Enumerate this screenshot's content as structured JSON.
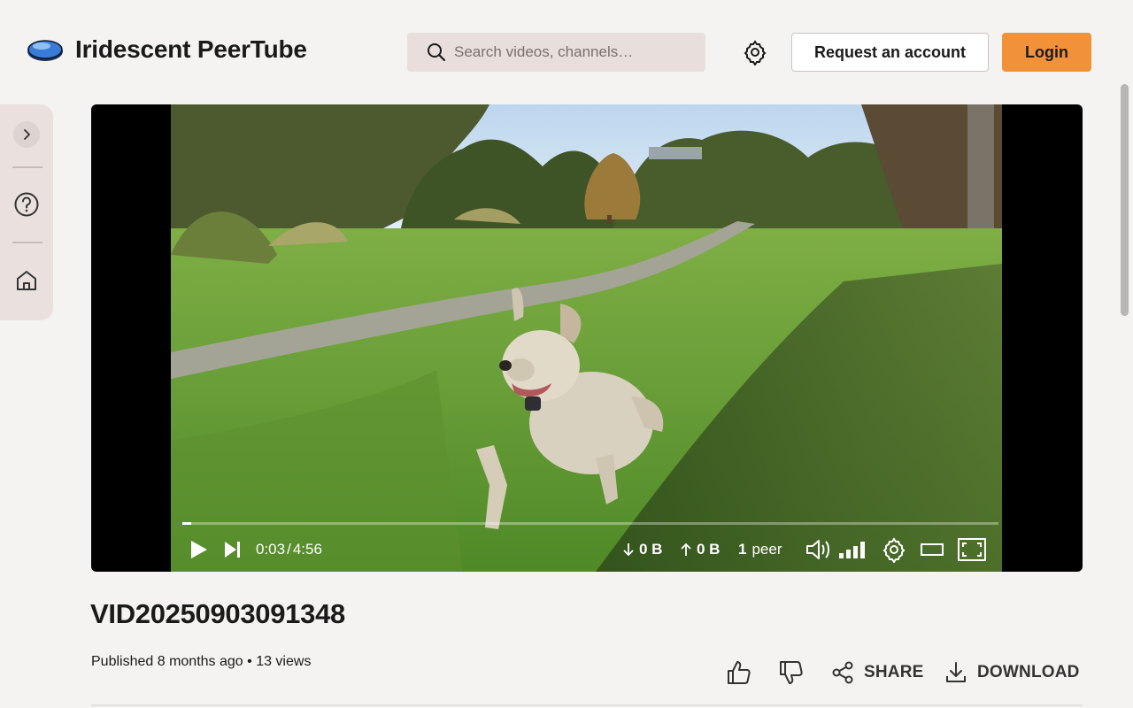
{
  "header": {
    "site_title": "Iridescent PeerTube",
    "search_placeholder": "Search videos, channels…",
    "request_account_label": "Request an account",
    "login_label": "Login"
  },
  "colors": {
    "accent": "#f1923a",
    "background": "#f4f3f2",
    "sidebar_bg": "#eae1df",
    "search_bg": "#e8dfdd"
  },
  "sidebar": {
    "items": [
      {
        "icon": "chevron-right-icon"
      },
      {
        "icon": "help-circle-icon"
      },
      {
        "icon": "home-icon"
      }
    ]
  },
  "player": {
    "current_time": "0:03",
    "duration": "4:56",
    "time_separator": "/",
    "progress_fraction": 0.011,
    "download_label": "0 B",
    "upload_label": "0 B",
    "peers_count": "1",
    "peers_label": "peer"
  },
  "video": {
    "title": "VID20250903091348",
    "published": "Published 8 months ago",
    "separator": "•",
    "views": "13 views"
  },
  "actions": {
    "share_label": "SHARE",
    "download_label": "DOWNLOAD"
  }
}
